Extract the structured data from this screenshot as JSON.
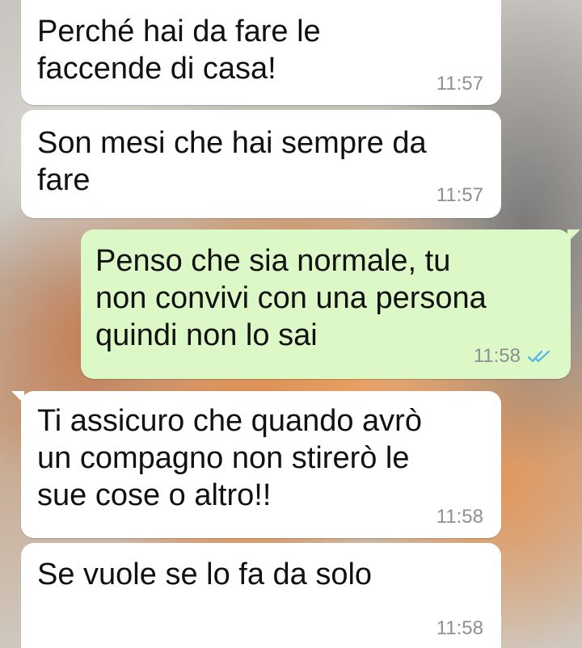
{
  "colors": {
    "incoming_bubble": "#ffffff",
    "outgoing_bubble": "#dcf8c6",
    "timestamp": "#8f8f8f",
    "read_receipt": "#4fb6ec"
  },
  "messages": [
    {
      "direction": "incoming",
      "text": "Perché hai da fare le\nfaccende di casa!",
      "time": "11:57"
    },
    {
      "direction": "incoming",
      "text": "Son mesi che hai sempre da\nfare",
      "time": "11:57"
    },
    {
      "direction": "outgoing",
      "text": "Penso che sia normale, tu\nnon convivi con una persona\nquindi non lo sai",
      "time": "11:58",
      "status_icon": "double-check-read-icon"
    },
    {
      "direction": "incoming",
      "text": "Ti assicuro che quando avrò\nun compagno non stirerò le\nsue cose o altro!!",
      "time": "11:58"
    },
    {
      "direction": "incoming",
      "text": "Se vuole se lo fa da solo",
      "time": "11:58"
    }
  ]
}
